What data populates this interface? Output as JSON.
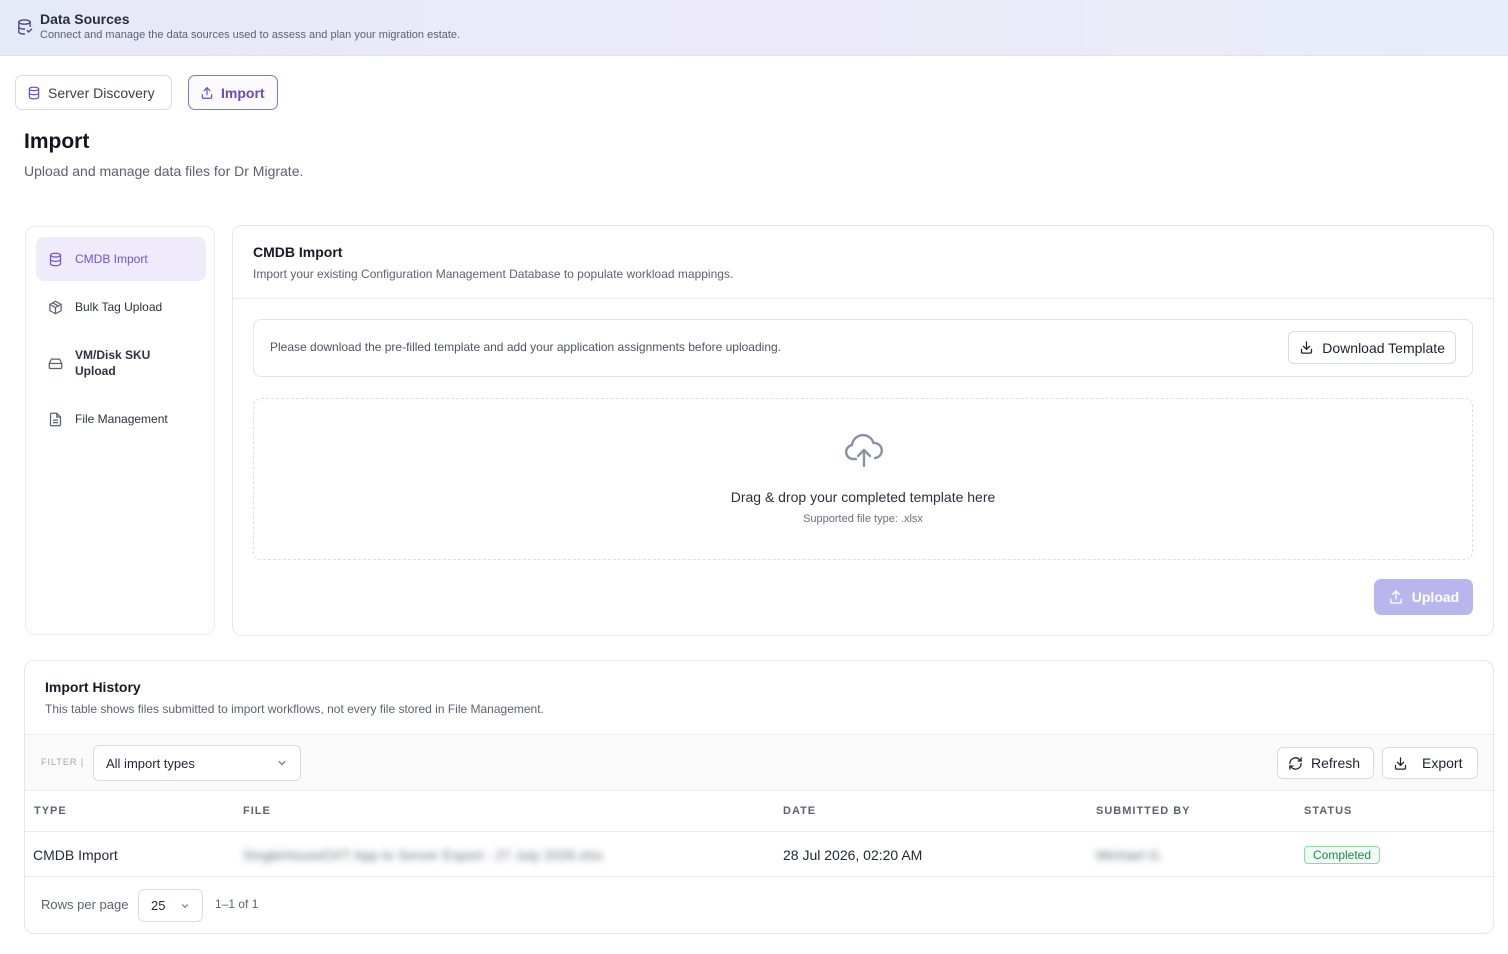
{
  "header": {
    "title": "Data Sources",
    "subtitle": "Connect and manage the data sources used to assess and plan your migration estate.",
    "icon": "database-icon"
  },
  "tabs": [
    {
      "label": "Server Discovery",
      "icon": "database-icon",
      "active": false
    },
    {
      "label": "Import",
      "icon": "upload-icon",
      "active": true
    }
  ],
  "page": {
    "title": "Import",
    "subtitle": "Upload and manage data files for Dr Migrate."
  },
  "sidebar": {
    "items": [
      {
        "label": "CMDB Import",
        "icon": "database-icon",
        "active": true
      },
      {
        "label": "Bulk Tag Upload",
        "icon": "box-icon",
        "active": false
      },
      {
        "label": "VM/Disk SKU Upload",
        "icon": "hard-drive-icon",
        "active": false
      },
      {
        "label": "File Management",
        "icon": "file-icon",
        "active": false
      }
    ]
  },
  "cmdb": {
    "title": "CMDB Import",
    "subtitle": "Import your existing Configuration Management Database to populate workload mappings.",
    "notice": "Please download the pre-filled template and add your application assignments before uploading.",
    "download_label": "Download Template",
    "dropzone_title": "Drag & drop your completed template here",
    "dropzone_sub": "Supported file type: .xlsx",
    "upload_label": "Upload"
  },
  "history": {
    "title": "Import History",
    "subtitle": "This table shows files submitted to import workflows, not every file stored in File Management.",
    "filter_label": "FILTER |",
    "filter_value": "All import types",
    "refresh_label": "Refresh",
    "export_label": "Export",
    "columns": [
      "TYPE",
      "FILE",
      "DATE",
      "SUBMITTED BY",
      "STATUS"
    ],
    "rows": [
      {
        "type": "CMDB Import",
        "file": "SingleHouseDXT App to Server Export - 27 July 2026.xlsx",
        "date": "28 Jul 2026, 02:20 AM",
        "submitted_by": "Michael G.",
        "status": "Completed"
      }
    ],
    "rows_per_page_label": "Rows per page",
    "rows_per_page": "25",
    "range": "1–1 of 1"
  },
  "colors": {
    "accent": "#7452d3",
    "status_completed": "#1e8a4a",
    "upload_disabled": "#b9b6ef"
  }
}
